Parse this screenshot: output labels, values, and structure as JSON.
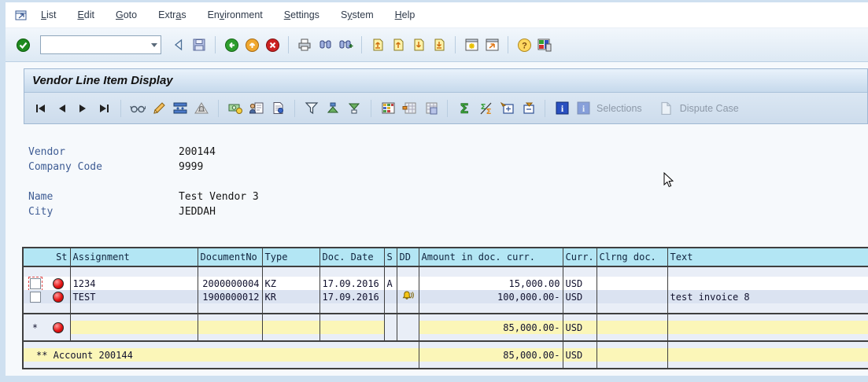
{
  "menu": {
    "items": [
      {
        "pre": "",
        "key": "L",
        "post": "ist"
      },
      {
        "pre": "",
        "key": "E",
        "post": "dit"
      },
      {
        "pre": "",
        "key": "G",
        "post": "oto"
      },
      {
        "pre": "Extr",
        "key": "a",
        "post": "s"
      },
      {
        "pre": "En",
        "key": "v",
        "post": "ironment"
      },
      {
        "pre": "",
        "key": "S",
        "post": "ettings"
      },
      {
        "pre": "S",
        "key": "y",
        "post": "stem"
      },
      {
        "pre": "",
        "key": "H",
        "post": "elp"
      }
    ]
  },
  "toolbar": {
    "command_value": ""
  },
  "title": "Vendor Line Item Display",
  "app_toolbar": {
    "selections": "Selections",
    "dispute": "Dispute Case"
  },
  "fields": [
    {
      "label": "Vendor",
      "value": "200144"
    },
    {
      "label": "Company Code",
      "value": "9999"
    },
    {
      "label": "Name",
      "value": "Test Vendor 3"
    },
    {
      "label": "City",
      "value": "JEDDAH"
    }
  ],
  "table": {
    "columns": [
      "St",
      "Assignment",
      "DocumentNo",
      "Type",
      "Doc. Date",
      "S",
      "DD",
      "Amount in doc. curr.",
      "Curr.",
      "Clrng doc.",
      "Text"
    ],
    "rows": [
      {
        "assignment": "1234",
        "document_no": "2000000004",
        "type": "KZ",
        "doc_date": "17.09.2016",
        "s": "A",
        "dd": "",
        "amount": "15,000.00",
        "curr": "USD",
        "clrng": "",
        "text": ""
      },
      {
        "assignment": "TEST",
        "document_no": "1900000012",
        "type": "KR",
        "doc_date": "17.09.2016",
        "s": "",
        "dd": "bell",
        "amount": "100,000.00-",
        "curr": "USD",
        "clrng": "",
        "text": "test invoice 8"
      }
    ],
    "subtotal": {
      "marker": "*",
      "amount": "85,000.00-",
      "curr": "USD"
    },
    "account": {
      "label": "** Account 200144",
      "amount": "85,000.00-",
      "curr": "USD"
    }
  },
  "colors": {
    "chrome_blue": "#cfe0f0",
    "header_cell": "#b3e6f4",
    "alt_row": "#dbe3f1",
    "total_yellow": "#fbf6b8",
    "section_bg": "#e9eef7",
    "grid_border": "#3f3f3f",
    "label_blue": "#3e5c94",
    "status_red": "#e61414",
    "bell_yellow": "#f5c518"
  }
}
